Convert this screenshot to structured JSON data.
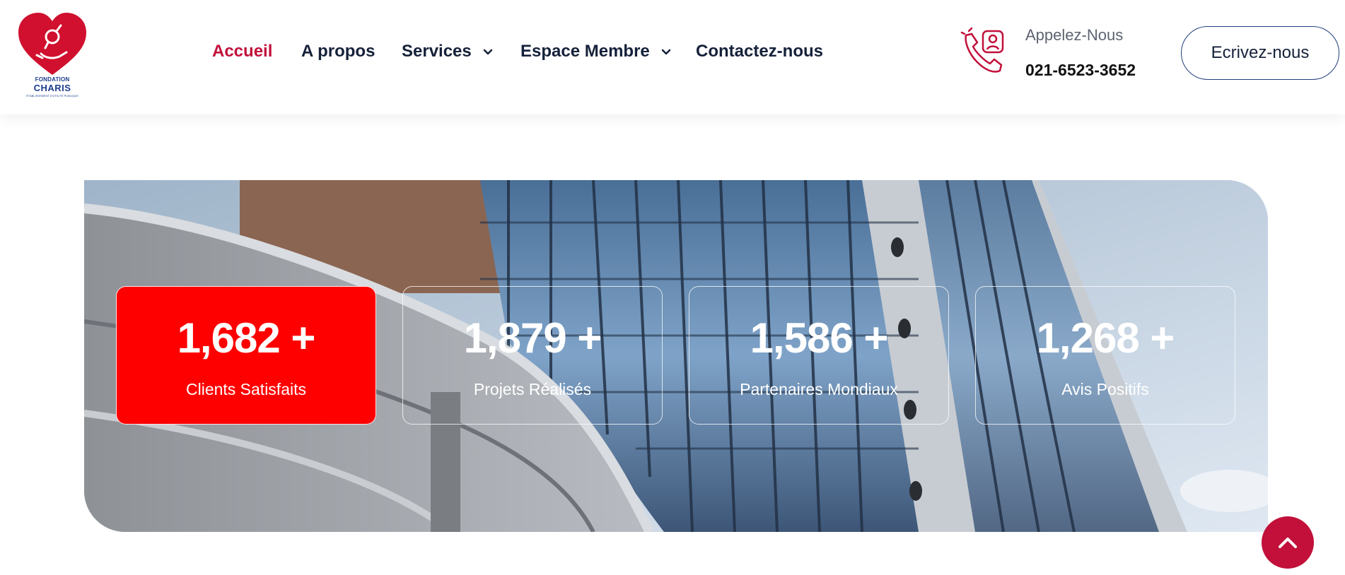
{
  "brand": {
    "logo_line1": "FONDATION",
    "logo_line2": "CHARIS",
    "logo_line3": "ÉTABLISSEMENT D'UTILITÉ PUBLIQUE"
  },
  "nav": [
    {
      "label": "Accueil",
      "active": true
    },
    {
      "label": "A propos"
    },
    {
      "label": "Services",
      "dropdown": true
    },
    {
      "label": "Espace Membre",
      "dropdown": true
    },
    {
      "label": "Contactez-nous"
    }
  ],
  "contact": {
    "call_label": "Appelez-Nous",
    "phone": "021-6523-3652",
    "write_button": "Ecrivez-nous"
  },
  "stats": [
    {
      "value": "1,682",
      "suffix": "+",
      "label": "Clients Satisfaits",
      "highlight": true
    },
    {
      "value": "1,879",
      "suffix": "+",
      "label": "Projets Réalisés"
    },
    {
      "value": "1,586",
      "suffix": "+",
      "label": "Partenaires Mondiaux"
    },
    {
      "value": "1,268",
      "suffix": "+",
      "label": "Avis Positifs"
    }
  ],
  "icons": {
    "phone": "phone-user-icon",
    "chevron": "chevron-down-icon",
    "scroll_top": "chevron-up-icon"
  },
  "colors": {
    "accent": "#c2103a",
    "highlight": "#ff0000",
    "text_dark": "#16213a",
    "button_border": "#1f3f7c"
  }
}
